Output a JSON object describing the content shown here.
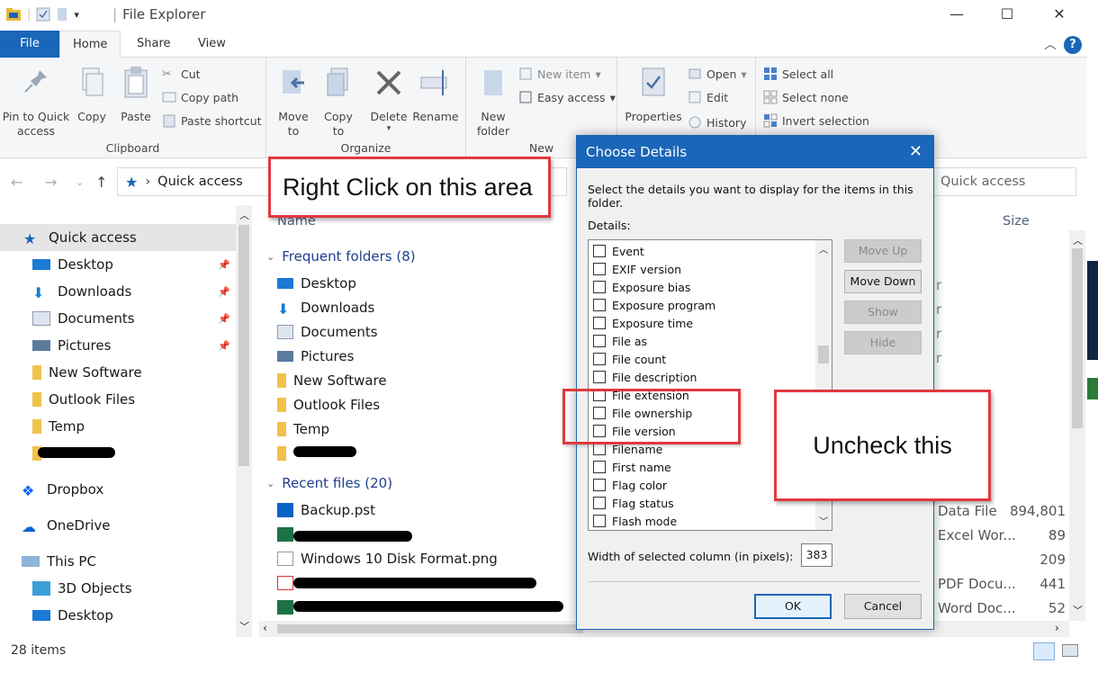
{
  "window": {
    "title": "File Explorer",
    "minimize_icon": "minimize-icon",
    "maximize_icon": "maximize-icon",
    "close_icon": "close-icon"
  },
  "ribbon_tabs": {
    "file": "File",
    "home": "Home",
    "share": "Share",
    "view": "View",
    "help": "?"
  },
  "ribbon": {
    "clipboard": {
      "label": "Clipboard",
      "pin": "Pin to Quick access",
      "copy": "Copy",
      "paste": "Paste",
      "cut": "Cut",
      "copy_path": "Copy path",
      "paste_shortcut": "Paste shortcut"
    },
    "organize": {
      "label": "Organize",
      "move_to": "Move to",
      "copy_to": "Copy to",
      "delete": "Delete",
      "rename": "Rename"
    },
    "new": {
      "label": "New",
      "new_folder": "New folder",
      "new_item": "New item",
      "easy_access": "Easy access"
    },
    "open": {
      "properties": "Properties",
      "open": "Open",
      "edit": "Edit",
      "history": "History"
    },
    "select": {
      "select_all": "Select all",
      "select_none": "Select none",
      "invert_selection": "Invert selection"
    }
  },
  "address": {
    "path": "Quick access",
    "search_placeholder": "Quick access"
  },
  "nav": {
    "quick_access": "Quick access",
    "items": [
      "Desktop",
      "Downloads",
      "Documents",
      "Pictures",
      "New Software",
      "Outlook Files",
      "Temp"
    ],
    "dropbox": "Dropbox",
    "onedrive": "OneDrive",
    "this_pc": "This PC",
    "pc_items": [
      "3D Objects",
      "Desktop"
    ]
  },
  "content": {
    "col_name": "Name",
    "col_size": "Size",
    "frequent_header": "Frequent folders (8)",
    "frequent": [
      "Desktop",
      "Downloads",
      "Documents",
      "Pictures",
      "New Software",
      "Outlook Files",
      "Temp"
    ],
    "recent_header": "Recent files (20)",
    "recent": [
      "Backup.pst",
      "Windows 10 Disk Format.png"
    ],
    "right_types": [
      "Data File",
      "Excel Wor...",
      "",
      "PDF Docu...",
      "Word Doc..."
    ],
    "right_sizes": [
      "894,801",
      "89",
      "209",
      "441",
      "52"
    ]
  },
  "status": {
    "count": "28 items"
  },
  "dialog": {
    "title": "Choose Details",
    "description": "Select the details you want to display for the items in this folder.",
    "details_label": "Details:",
    "details": [
      "Event",
      "EXIF version",
      "Exposure bias",
      "Exposure program",
      "Exposure time",
      "File as",
      "File count",
      "File description",
      "File extension",
      "File ownership",
      "File version",
      "Filename",
      "First name",
      "Flag color",
      "Flag status",
      "Flash mode"
    ],
    "move_up": "Move Up",
    "move_down": "Move Down",
    "show": "Show",
    "hide": "Hide",
    "width_label": "Width of selected column (in pixels):",
    "width_value": "383",
    "ok": "OK",
    "cancel": "Cancel"
  },
  "annotations": {
    "right_click": "Right Click on this area",
    "uncheck": "Uncheck this"
  }
}
